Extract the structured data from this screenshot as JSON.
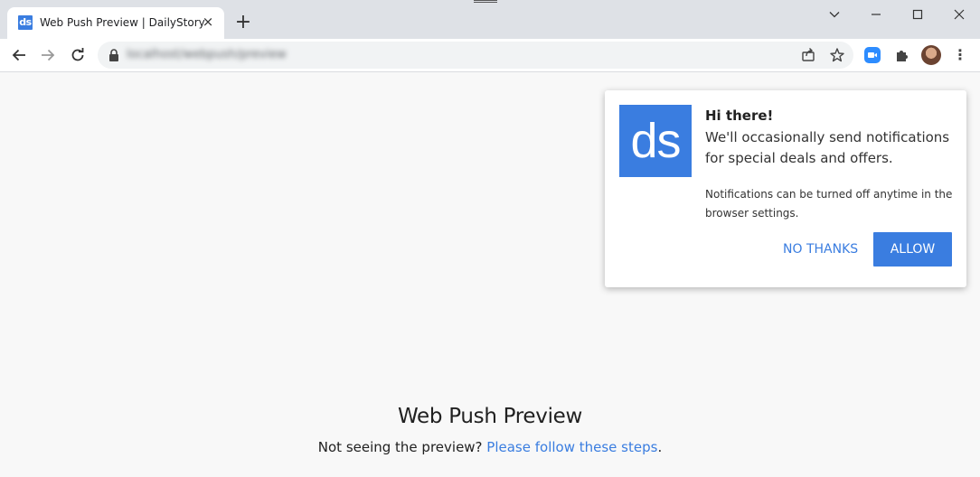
{
  "browser": {
    "tab_favicon": "ds",
    "tab_title": "Web Push Preview | DailyStory",
    "tab_close": "×",
    "new_tab": "+",
    "url": "localhost/webpush/preview",
    "kebab": "⋮"
  },
  "page": {
    "title": "Web Push Preview",
    "subtitle_prefix": "Not seeing the preview? ",
    "subtitle_link": "Please follow these steps",
    "subtitle_suffix": "."
  },
  "prompt": {
    "logo": "ds",
    "heading": "Hi there!",
    "body": "We'll occasionally send notifications for special deals and offers.",
    "note": "Notifications can be turned off anytime in the browser settings.",
    "decline_label": "NO THANKS",
    "accept_label": "ALLOW"
  },
  "colors": {
    "brand": "#3a7de0",
    "page_bg": "#f8f8f8",
    "tabstrip_bg": "#dee1e6"
  }
}
